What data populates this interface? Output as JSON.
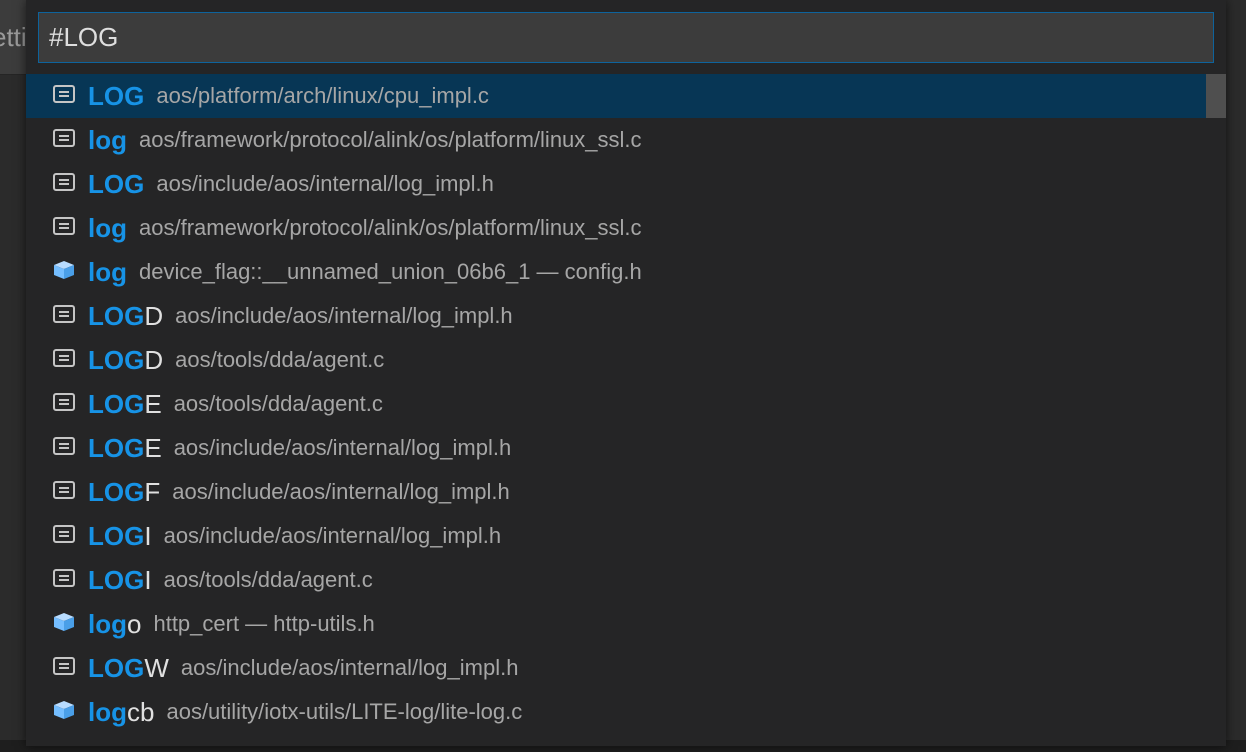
{
  "background": {
    "tab_label": "etti"
  },
  "search": {
    "value": "#LOG"
  },
  "results": [
    {
      "icon": "constant-icon",
      "match": "LOG",
      "rest": "",
      "detail": "aos/platform/arch/linux/cpu_impl.c",
      "selected": true
    },
    {
      "icon": "constant-icon",
      "match": "log",
      "rest": "",
      "detail": "aos/framework/protocol/alink/os/platform/linux_ssl.c"
    },
    {
      "icon": "constant-icon",
      "match": "LOG",
      "rest": "",
      "detail": "aos/include/aos/internal/log_impl.h"
    },
    {
      "icon": "constant-icon",
      "match": "log",
      "rest": "",
      "detail": "aos/framework/protocol/alink/os/platform/linux_ssl.c"
    },
    {
      "icon": "field-icon",
      "match": "log",
      "rest": "",
      "detail": "device_flag::__unnamed_union_06b6_1 — config.h"
    },
    {
      "icon": "constant-icon",
      "match": "LOG",
      "rest": "D",
      "detail": "aos/include/aos/internal/log_impl.h"
    },
    {
      "icon": "constant-icon",
      "match": "LOG",
      "rest": "D",
      "detail": "aos/tools/dda/agent.c"
    },
    {
      "icon": "constant-icon",
      "match": "LOG",
      "rest": "E",
      "detail": "aos/tools/dda/agent.c"
    },
    {
      "icon": "constant-icon",
      "match": "LOG",
      "rest": "E",
      "detail": "aos/include/aos/internal/log_impl.h"
    },
    {
      "icon": "constant-icon",
      "match": "LOG",
      "rest": "F",
      "detail": "aos/include/aos/internal/log_impl.h"
    },
    {
      "icon": "constant-icon",
      "match": "LOG",
      "rest": "I",
      "detail": "aos/include/aos/internal/log_impl.h"
    },
    {
      "icon": "constant-icon",
      "match": "LOG",
      "rest": "I",
      "detail": "aos/tools/dda/agent.c"
    },
    {
      "icon": "field-icon",
      "match": "log",
      "rest": "o",
      "detail": "http_cert — http-utils.h"
    },
    {
      "icon": "constant-icon",
      "match": "LOG",
      "rest": "W",
      "detail": "aos/include/aos/internal/log_impl.h"
    },
    {
      "icon": "field-icon",
      "match": "log",
      "rest": "cb",
      "detail": "aos/utility/iotx-utils/LITE-log/lite-log.c"
    }
  ],
  "colors": {
    "match": "#1793e6",
    "selected_bg": "#073655",
    "input_border": "#0e639c",
    "icon_constant": "#c5c5c5",
    "icon_field": "#75beff"
  }
}
